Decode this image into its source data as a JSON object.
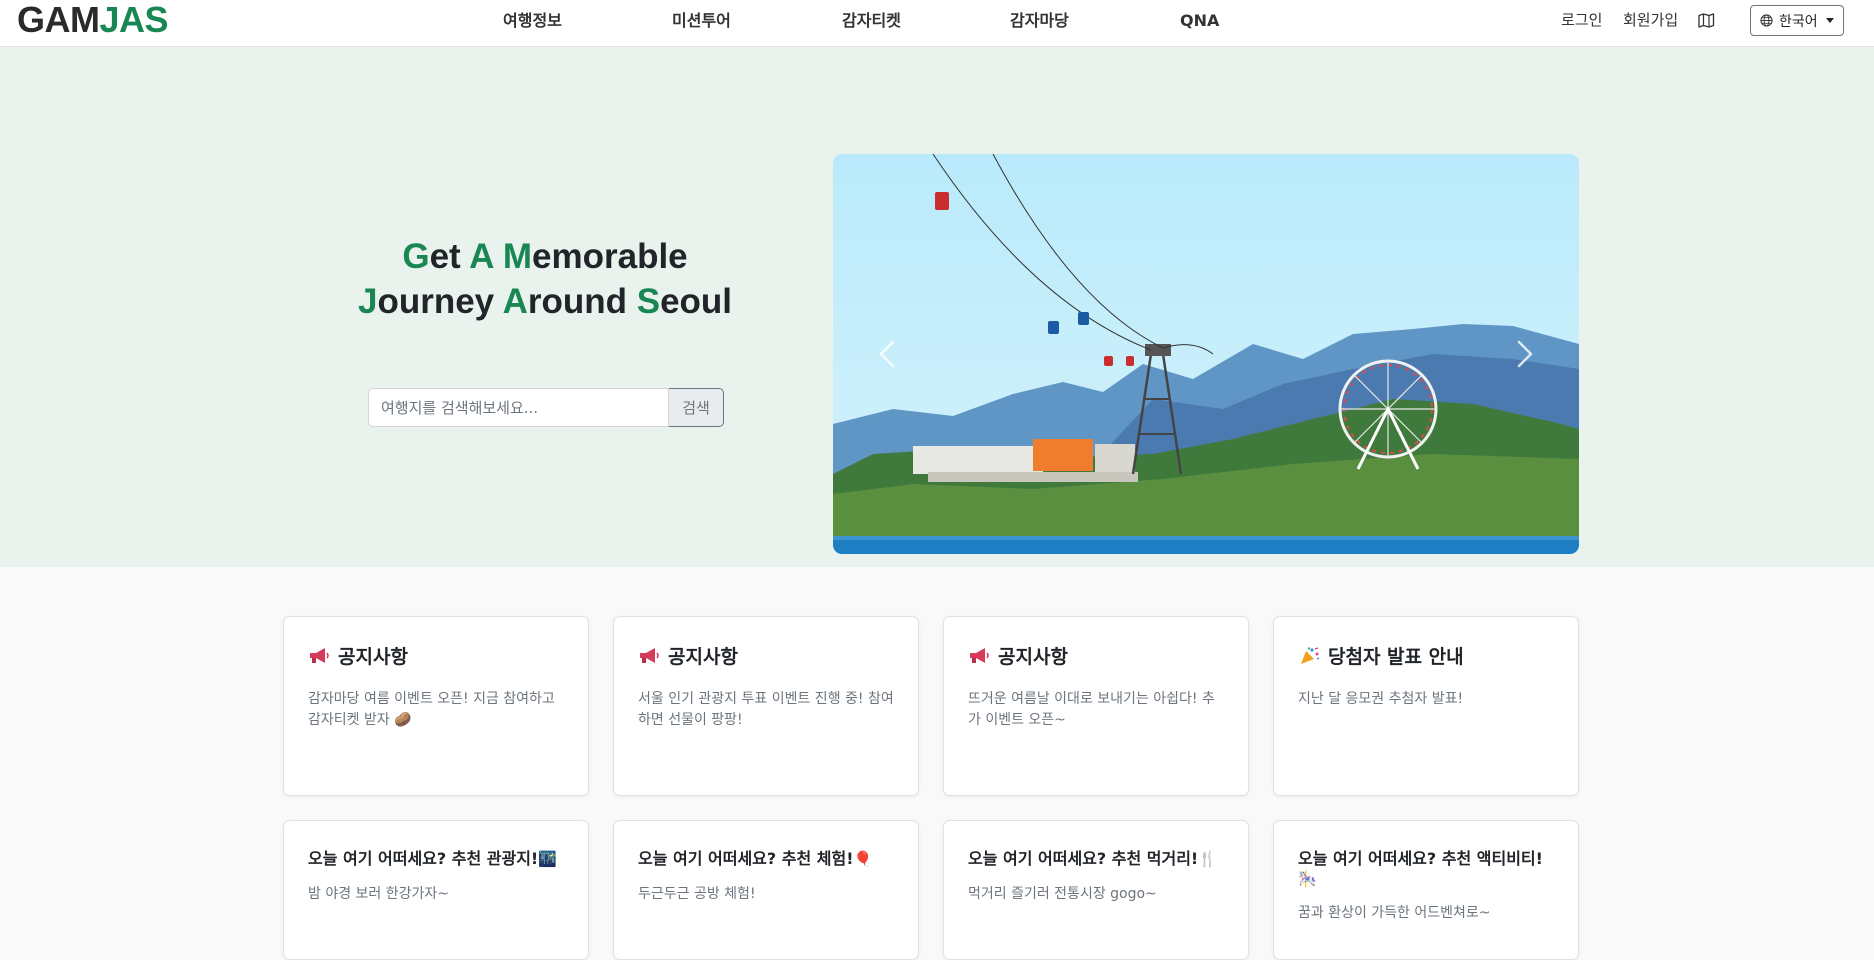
{
  "header": {
    "logo_part1": "GAM",
    "logo_part2": "JAS",
    "nav": [
      "여행정보",
      "미션투어",
      "감자티켓",
      "감자마당",
      "QNA"
    ],
    "login": "로그인",
    "signup": "회원가입",
    "language": "한국어"
  },
  "hero": {
    "title_line1": [
      "G",
      "et ",
      "A",
      " ",
      "M",
      "emorable"
    ],
    "title_line2": [
      "J",
      "ourney ",
      "A",
      "round ",
      "S",
      "eoul"
    ],
    "search_placeholder": "여행지를 검색해보세요...",
    "search_button": "검색"
  },
  "notices": [
    {
      "icon": "megaphone-icon",
      "title": "공지사항",
      "desc": "감자마당 여름 이벤트 오픈! 지금 참여하고 감자티켓 받자 🥔"
    },
    {
      "icon": "megaphone-icon",
      "title": "공지사항",
      "desc": "서울 인기 관광지 투표 이벤트 진행 중! 참여하면 선물이 팡팡!"
    },
    {
      "icon": "megaphone-icon",
      "title": "공지사항",
      "desc": "뜨거운 여름날 이대로 보내기는 아쉽다! 추가 이벤트 오픈~"
    },
    {
      "icon": "confetti-icon",
      "title": "당첨자 발표 안내",
      "desc": "지난 달 응모권 추첨자 발표!"
    }
  ],
  "recommendations": [
    {
      "title": "오늘 여기 어떠세요? 추천 관광지!",
      "emoji": "🌃",
      "desc": "밤 야경 보러 한강가자~"
    },
    {
      "title": "오늘 여기 어떠세요? 추천 체험!",
      "emoji": "🎈",
      "desc": "두근두근 공방 체험!"
    },
    {
      "title": "오늘 여기 어떠세요? 추천 먹거리!",
      "emoji": "🍴",
      "desc": "먹거리 즐기러 전통시장 gogo~"
    },
    {
      "title": "오늘 여기 어떠세요? 추천 액티비티!",
      "emoji": "🎠",
      "desc": "꿈과 환상이 가득한 어드벤쳐로~"
    }
  ],
  "colors": {
    "accent": "#198754",
    "hero_bg": "#e9f2ed"
  }
}
